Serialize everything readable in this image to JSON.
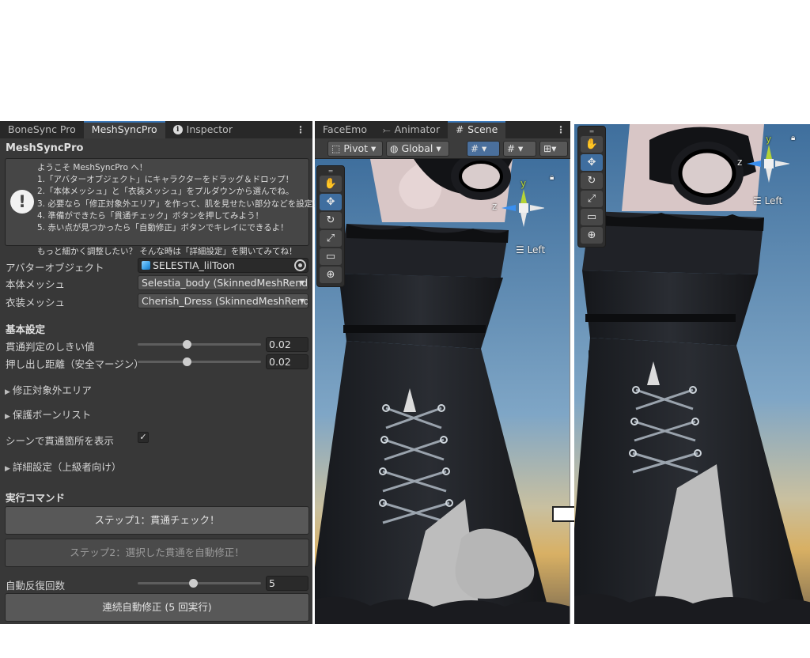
{
  "left_window": {
    "tabs": [
      {
        "label": "BoneSync Pro",
        "active": false
      },
      {
        "label": "MeshSyncPro",
        "active": true
      },
      {
        "label": "Inspector",
        "active": false,
        "icon": "info-icon"
      }
    ],
    "title": "MeshSyncPro",
    "help": {
      "icon": "exclamation-icon",
      "lines": [
        "ようこそ MeshSyncPro へ！",
        "1.「アバターオブジェクト」にキャラクターをドラッグ＆ドロップ！",
        "2.「本体メッシュ」と「衣装メッシュ」をプルダウンから選んでね。",
        "3. 必要なら「修正対象外エリア」を作って、肌を見せたい部分などを設定！",
        "4. 準備ができたら「貫通チェック」ボタンを押してみよう！",
        "5. 赤い点が見つかったら「自動修正」ボタンでキレイにできるよ！",
        "",
        "もっと細かく調整したい？ そんな時は「詳細設定」を開いてみてね！"
      ]
    },
    "avatar_field": {
      "label": "アバターオブジェクト",
      "value": "SELESTIA_lilToon"
    },
    "body_mesh": {
      "label": "本体メッシュ",
      "value": "Selestia_body (SkinnedMeshRenderer)"
    },
    "cloth_mesh": {
      "label": "衣装メッシュ",
      "value": "Cherish_Dress (SkinnedMeshRenderer)"
    },
    "basic_settings": {
      "heading": "基本設定",
      "threshold": {
        "label": "貫通判定のしきい値",
        "value": "0.02",
        "slider_fraction": 0.4
      },
      "push_distance": {
        "label": "押し出し距離（安全マージン）",
        "value": "0.02",
        "slider_fraction": 0.4
      }
    },
    "foldouts": {
      "exclude_area": "修正対象外エリア",
      "protected_bones": "保護ボーンリスト",
      "advanced": "詳細設定（上級者向け）"
    },
    "show_in_scene": {
      "label": "シーンで貫通箇所を表示",
      "checked": true,
      "check_glyph": "✓"
    },
    "commands": {
      "heading": "実行コマンド",
      "step1": "ステップ1：貫通チェック！",
      "step2": "ステップ2：選択した貫通を自動修正！",
      "auto_repeat": {
        "label": "自動反復回数",
        "value": "5",
        "slider_fraction": 0.45
      },
      "continuous": "連続自動修正 (5 回実行)"
    }
  },
  "scene_window": {
    "tabs": [
      {
        "label": "FaceEmo",
        "active": false
      },
      {
        "label": "Animator",
        "active": false,
        "icon": "animator-icon"
      },
      {
        "label": "Scene",
        "active": true,
        "icon": "grid-icon"
      }
    ],
    "toolbar": {
      "pivot": "Pivot",
      "global": "Global"
    },
    "gizmo": {
      "y": "y",
      "z": "z",
      "view": "Left"
    }
  },
  "after_view": {
    "gizmo": {
      "y": "y",
      "z": "z",
      "view": "Left"
    }
  },
  "colors": {
    "panel_bg": "#383838",
    "tab_active_accent": "#3a79bb",
    "gizmo_y": "#b5d336",
    "gizmo_z": "#3a8ff0",
    "dress": "#1c1e22",
    "sky": "#6b8fb0"
  }
}
